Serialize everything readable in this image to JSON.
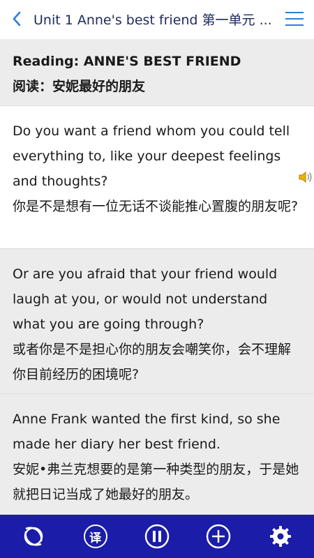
{
  "header": {
    "title": "Unit 1 Anne's best friend 第一单元 ...",
    "back_icon": "chevron-left-icon",
    "menu_icon": "hamburger-menu-icon",
    "accent_color": "#2a7de1"
  },
  "section": {
    "title_en": "Reading: ANNE'S BEST FRIEND",
    "title_zh": "阅读：安妮最好的朋友"
  },
  "paragraphs": [
    {
      "en": "Do you want a friend whom you could tell everything to, like your deepest feelings and thoughts?",
      "zh": "你是不是想有一位无话不谈能推心置腹的朋友呢?"
    },
    {
      "en": "Or are you afraid that your friend would laugh at you, or would not understand what you are going through?",
      "zh": "或者你是不是担心你的朋友会嘲笑你，会不理解你目前经历的困境呢?"
    },
    {
      "en": "Anne Frank wanted the first kind, so she made her diary her best friend.",
      "zh": "安妮•弗兰克想要的是第一种类型的朋友，于是她就把日记当成了她最好的朋友。"
    }
  ],
  "speaker_icon": "speaker-icon",
  "bottom_bar": {
    "color": "#1b1ca8",
    "translate_label": "译",
    "buttons": [
      "loop-icon",
      "translate-icon",
      "pause-icon",
      "add-icon",
      "settings-icon"
    ]
  }
}
